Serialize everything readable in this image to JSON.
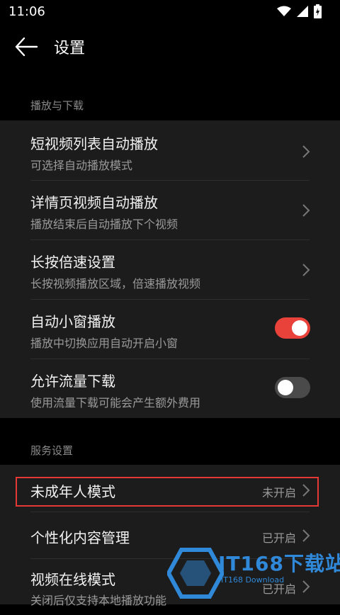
{
  "status_bar": {
    "time": "11:06"
  },
  "app_bar": {
    "title": "设置"
  },
  "sections": {
    "playback": {
      "label": "播放与下载"
    },
    "service": {
      "label": "服务设置"
    }
  },
  "rows": {
    "short_video": {
      "title": "短视频列表自动播放",
      "subtitle": "可选择自动播放模式"
    },
    "detail_video": {
      "title": "详情页视频自动播放",
      "subtitle": "播放结束后自动播放下个视频"
    },
    "long_press": {
      "title": "长按倍速设置",
      "subtitle": "长按视频播放区域，倍速播放视频"
    },
    "mini_window": {
      "title": "自动小窗播放",
      "subtitle": "播放中切换应用自动开启小窗",
      "enabled": true
    },
    "data_download": {
      "title": "允许流量下载",
      "subtitle": "使用流量下载可能会产生额外费用",
      "enabled": false
    },
    "minor_mode": {
      "title": "未成年人模式",
      "value": "未开启"
    },
    "personalized": {
      "title": "个性化内容管理",
      "value": "已开启"
    },
    "online_mode": {
      "title": "视频在线模式",
      "subtitle": "关闭后仅支持本地播放功能",
      "value": "已开启"
    }
  },
  "watermark": {
    "text": "IT168下载站",
    "subtext": "IT168 Download"
  },
  "colors": {
    "toggle_on": "#e9423a",
    "toggle_off": "#4a4a4a",
    "highlight": "#e53935",
    "card_bg": "#1c1c1c"
  }
}
